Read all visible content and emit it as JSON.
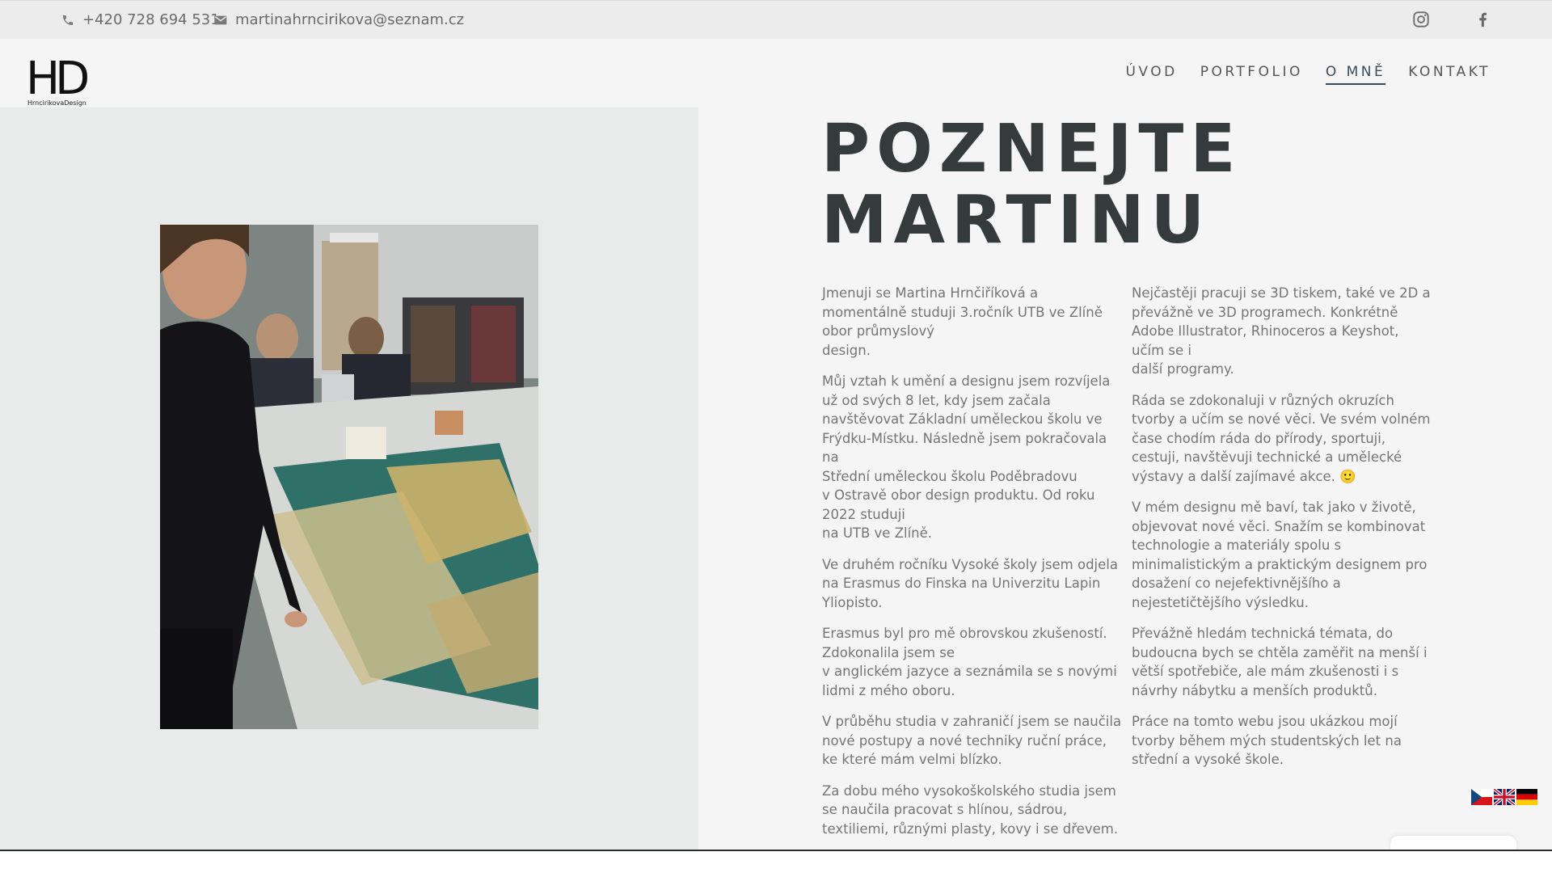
{
  "topbar": {
    "phone": "+420 728 694 531",
    "email": "martinahrncirikova@seznam.cz",
    "icons": [
      "phone-icon",
      "envelope-icon",
      "instagram-icon",
      "facebook-icon"
    ]
  },
  "logo": {
    "mark": "HD",
    "text": "HrncirikovaDesign"
  },
  "nav": {
    "items": [
      {
        "label": "ÚVOD"
      },
      {
        "label": "PORTFOLIO"
      },
      {
        "label": "O MNĚ",
        "active": true
      },
      {
        "label": "KONTAKT"
      }
    ]
  },
  "hero": {
    "title_line1": "POZNEJTE",
    "title_line2": "MARTINU"
  },
  "content": {
    "left_paragraphs": [
      "Jmenuji se Martina Hrnčiříková a\nmomentálně studuji 3.ročník UTB ve Zlíně obor průmyslový\ndesign.",
      "Můj vztah k umění a designu jsem rozvíjela už od svých 8 let, kdy jsem začala navštěvovat Základní uměleckou školu ve Frýdku-Místku. Následně jsem pokračovala na\nStřední uměleckou školu Poděbradovu\nv Ostravě obor design produktu. Od roku 2022 studuji\nna UTB ve Zlíně.",
      "Ve druhém ročníku Vysoké školy jsem odjela na Erasmus do Finska na Univerzitu Lapin Yliopisto.",
      "Erasmus byl pro mě obrovskou zkušeností. Zdokonalila jsem se\nv anglickém jazyce a seznámila se s novými lidmi z mého oboru.",
      "V průběhu studia v zahraničí jsem se naučila nové postupy a nové techniky ruční práce, ke které mám velmi blízko.",
      "Za dobu mého vysokoškolského studia jsem se naučila pracovat s hlínou, sádrou, textiliemi, různými plasty, kovy i se dřevem."
    ],
    "right_paragraphs": [
      "Nejčastěji pracuji se 3D tiskem, také ve 2D a\npřevážně ve 3D programech. Konkrétně Adobe Illustrator, Rhinoceros a Keyshot, učím se i\ndalší programy.",
      "Ráda se zdokonaluji v různých okruzích tvorby a učím se nové věci. Ve svém volném čase chodím ráda do přírody, sportuji, cestuji, navštěvuji technické a umělecké\nvýstavy a další zajímavé akce. 🙂",
      "V mém designu mě baví, tak jako v životě, objevovat nové věci. Snažím se kombinovat technologie a materiály spolu s minimalistickým a praktickým designem pro dosažení co nejefektivnějšího a nejestetičtějšího výsledku.",
      "Převážně hledám technická témata, do budoucna bych se chtěla zaměřit na menší i větší spotřebiče, ale mám zkušenosti i s návrhy nábytku a menších produktů.",
      "Práce na tomto webu jsou ukázkou mojí tvorby během mých studentských let na střední a vysoké škole."
    ]
  },
  "language_switcher": {
    "flags": [
      "czech-flag-icon",
      "uk-flag-icon",
      "german-flag-icon"
    ]
  },
  "colors": {
    "title": "#353a3a",
    "body_text": "#757575",
    "nav_active": "#3a4b5c",
    "topbar_bg": "#ececec",
    "photo_panel_bg": "#e9eaea"
  }
}
